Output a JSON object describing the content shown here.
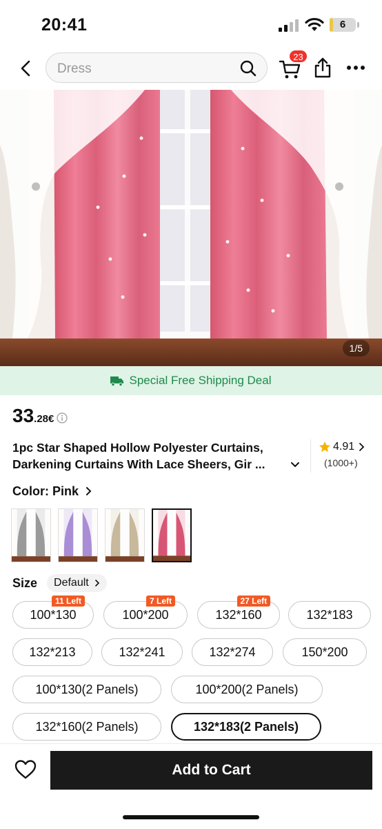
{
  "status_bar": {
    "time": "20:41",
    "battery": "6",
    "battery_level": 0.06
  },
  "search": {
    "placeholder": "Dress"
  },
  "cart": {
    "badge_count": "23"
  },
  "gallery": {
    "counter": "1/5"
  },
  "shipping": {
    "text": "Special Free Shipping Deal",
    "color": "#1f8a4c"
  },
  "price": {
    "main": "33",
    "decimal": ".28€"
  },
  "product": {
    "title": "1pc Star Shaped Hollow Polyester Curtains, Darkening Curtains With Lace Sheers, Gir ...",
    "rating": "4.91",
    "rating_count": "(1000+)"
  },
  "color": {
    "label": "Color:",
    "value": "Pink",
    "swatches": [
      {
        "name": "Gray",
        "color": "#9a9a9a"
      },
      {
        "name": "Purple",
        "color": "#a98ed6"
      },
      {
        "name": "Beige",
        "color": "#c8b89c"
      },
      {
        "name": "Pink",
        "color": "#d85675"
      }
    ]
  },
  "size": {
    "label": "Size",
    "default_label": "Default",
    "options": [
      {
        "label": "100*130",
        "stock": "11 Left"
      },
      {
        "label": "100*200",
        "stock": "7 Left"
      },
      {
        "label": "132*160",
        "stock": "27 Left"
      },
      {
        "label": "132*183"
      },
      {
        "label": "132*213"
      },
      {
        "label": "132*241"
      },
      {
        "label": "132*274"
      },
      {
        "label": "150*200"
      },
      {
        "label": "100*130(2 Panels)"
      },
      {
        "label": "100*200(2 Panels)"
      },
      {
        "label": "132*160(2 Panels)"
      },
      {
        "label": "132*183(2 Panels)",
        "selected": true
      }
    ]
  },
  "actions": {
    "add_to_cart": "Add to Cart"
  },
  "theme": {
    "accent": "#f15a24",
    "badge": "#f0312a",
    "curtain_pink": "#e76c87"
  }
}
